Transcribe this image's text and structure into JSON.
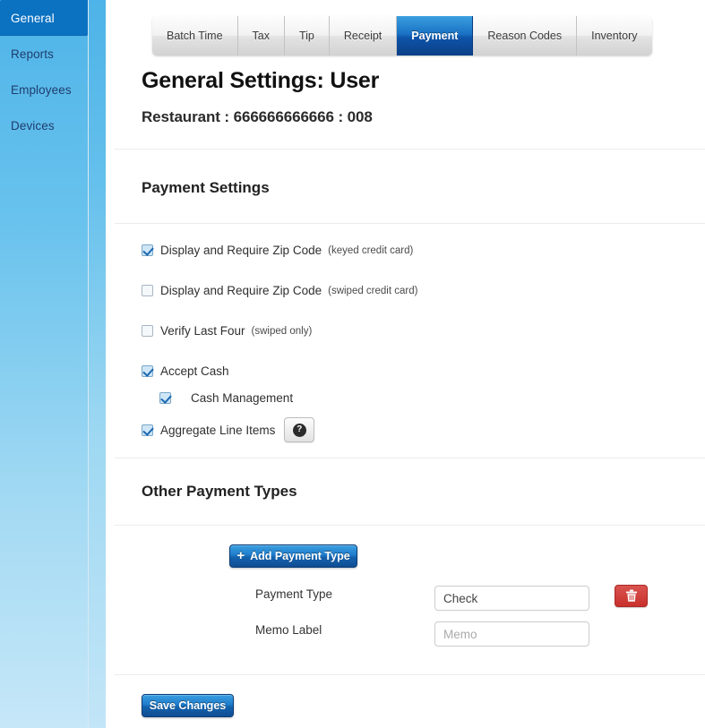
{
  "sidebar": {
    "items": [
      {
        "label": "General",
        "active": true
      },
      {
        "label": "Reports",
        "active": false
      },
      {
        "label": "Employees",
        "active": false
      },
      {
        "label": "Devices",
        "active": false
      }
    ]
  },
  "tabs": [
    {
      "label": "Batch Time",
      "active": false
    },
    {
      "label": "Tax",
      "active": false
    },
    {
      "label": "Tip",
      "active": false
    },
    {
      "label": "Receipt",
      "active": false
    },
    {
      "label": "Payment",
      "active": true
    },
    {
      "label": "Reason Codes",
      "active": false
    },
    {
      "label": "Inventory",
      "active": false
    }
  ],
  "header": {
    "title": "General Settings: User",
    "subtitle": "Restaurant : 666666666666 : 008"
  },
  "payment_settings": {
    "section_title": "Payment Settings",
    "checkboxes": [
      {
        "label": "Display and Require Zip Code",
        "note": "(keyed credit card)",
        "checked": true,
        "indent": false
      },
      {
        "label": "Display and Require Zip Code",
        "note": "(swiped credit card)",
        "checked": false,
        "indent": false
      },
      {
        "label": "Verify Last Four",
        "note": "(swiped only)",
        "checked": false,
        "indent": false
      },
      {
        "label": "Accept Cash",
        "note": "",
        "checked": true,
        "indent": false
      },
      {
        "label": "Cash Management",
        "note": "",
        "checked": true,
        "indent": true
      },
      {
        "label": "Aggregate Line Items",
        "note": "",
        "checked": true,
        "indent": false
      }
    ],
    "help_icon": "question-mark-icon",
    "help_glyph": "?"
  },
  "other_payment_types": {
    "section_title": "Other Payment Types",
    "add_button_label": "Add Payment Type",
    "add_button_icon": "plus-icon",
    "plus_glyph": "+",
    "rows": [
      {
        "payment_type_label": "Payment Type",
        "payment_type_value": "Check",
        "memo_label": "Memo Label",
        "memo_value": "",
        "memo_placeholder": "Memo",
        "delete_icon": "trash-icon"
      }
    ]
  },
  "footer": {
    "save_label": "Save Changes"
  },
  "colors": {
    "sidebar_active": "#0b71c1",
    "tab_active": "#1463ae",
    "button_blue": "#1f7ccb",
    "delete_red": "#c9302c",
    "checkbox_check": "#1c68b0"
  }
}
